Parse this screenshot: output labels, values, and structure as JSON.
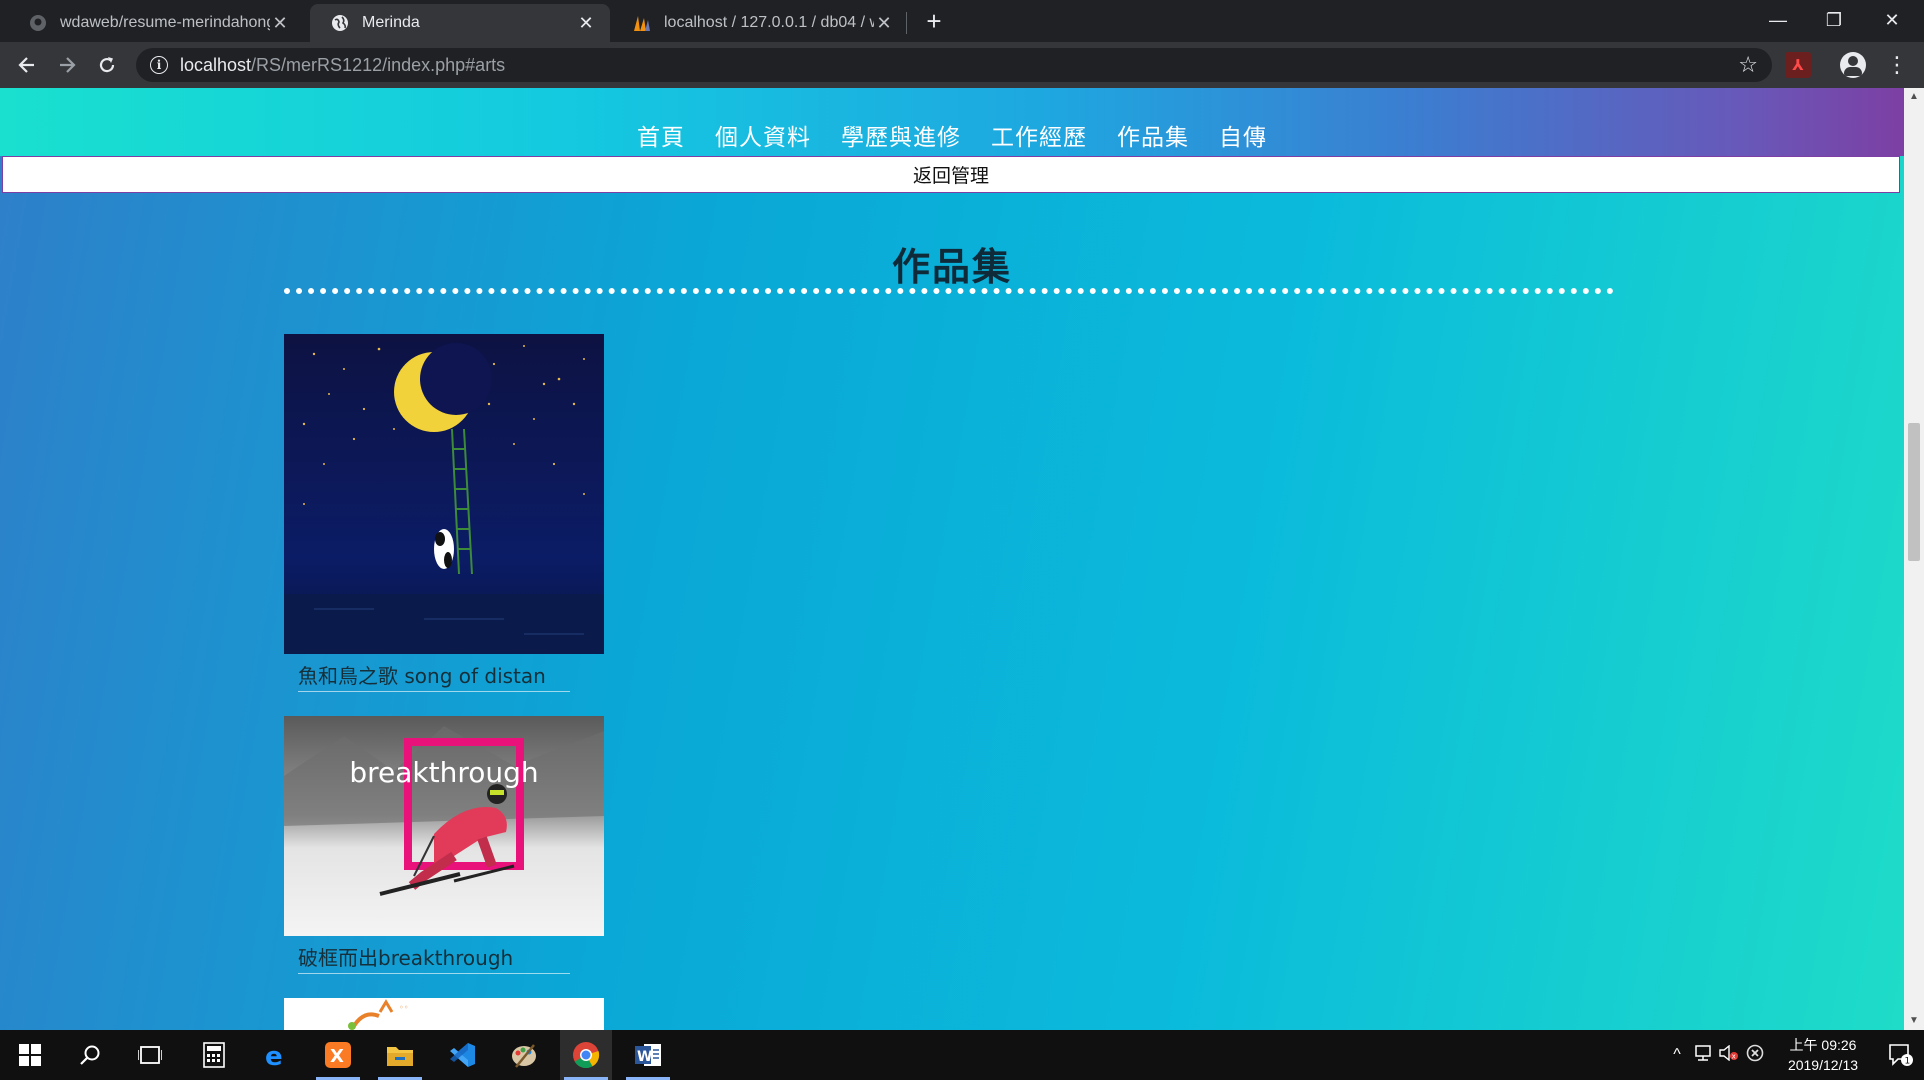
{
  "browser": {
    "tabs": [
      {
        "title": "wdaweb/resume-merindahong",
        "favicon": "github-icon",
        "active": false
      },
      {
        "title": "Merinda",
        "favicon": "globe-icon",
        "active": true
      },
      {
        "title": "localhost / 127.0.0.1 / db04 / w",
        "favicon": "phpmyadmin-icon",
        "active": false
      }
    ],
    "new_tab": "+",
    "address": {
      "host": "localhost",
      "path": "/RS/merRS1212/index.php#arts"
    },
    "window_controls": {
      "minimize": "—",
      "restore": "❐",
      "close": "✕"
    }
  },
  "site": {
    "nav": [
      {
        "label": "首頁"
      },
      {
        "label": "個人資料"
      },
      {
        "label": "學歷與進修"
      },
      {
        "label": "工作經歷"
      },
      {
        "label": "作品集"
      },
      {
        "label": "自傳"
      }
    ],
    "admin_link": "返回管理",
    "section_title": "作品集",
    "artworks": [
      {
        "caption": "魚和鳥之歌 song of distan",
        "image": "moon-ladder-panda-artwork"
      },
      {
        "caption": "破框而出breakthrough",
        "image": "skier-breakthrough-artwork",
        "image_text": "breakthrough"
      },
      {
        "caption": "",
        "image": "partial-logo-artwork"
      }
    ]
  },
  "taskbar": {
    "apps": [
      "windows-start",
      "search",
      "task-view",
      "calculator",
      "edge",
      "xampp",
      "file-explorer",
      "vscode",
      "paint",
      "chrome",
      "word"
    ],
    "clock": {
      "period_time": "上午 09:26",
      "date": "2019/12/13"
    },
    "notification_count": "1"
  },
  "colors": {
    "header_gradient": [
      "#19e0cf",
      "#1ea7e0",
      "#7d3fa3"
    ],
    "page_gradient": [
      "#2f7fc9",
      "#0aa7d6",
      "#1edcc8"
    ]
  }
}
